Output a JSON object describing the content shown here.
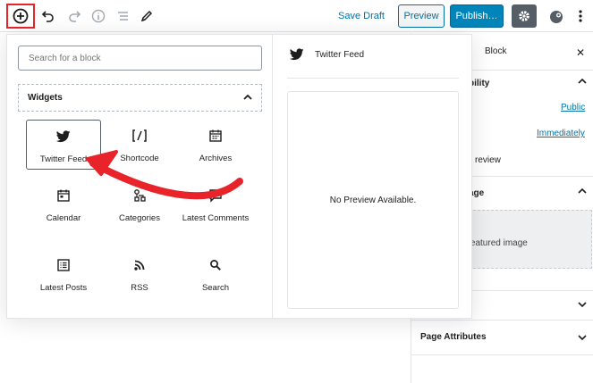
{
  "toolbar": {
    "save_draft": "Save Draft",
    "preview": "Preview",
    "publish": "Publish…",
    "icons": [
      "add-block-icon",
      "undo-icon",
      "redo-icon",
      "info-icon",
      "list-view-icon",
      "edit-pencil-icon",
      "gear-icon",
      "plugin-icon",
      "more-options-icon"
    ],
    "highlight_color": "#e8232a"
  },
  "inserter": {
    "search_placeholder": "Search for a block",
    "panel_title": "Widgets",
    "blocks": [
      {
        "label": "Twitter Feed",
        "icon": "twitter-icon",
        "selected": true
      },
      {
        "label": "Shortcode",
        "icon": "shortcode-icon"
      },
      {
        "label": "Archives",
        "icon": "calendar-archive-icon"
      },
      {
        "label": "Calendar",
        "icon": "calendar-icon"
      },
      {
        "label": "Categories",
        "icon": "categories-icon"
      },
      {
        "label": "Latest Comments",
        "icon": "comment-icon"
      },
      {
        "label": "Latest Posts",
        "icon": "posts-list-icon"
      },
      {
        "label": "RSS",
        "icon": "rss-icon"
      },
      {
        "label": "Search",
        "icon": "search-icon"
      }
    ],
    "preview": {
      "title": "Twitter Feed",
      "message": "No Preview Available."
    }
  },
  "sidebar": {
    "block_tab": "Block",
    "close": "✕",
    "visibility_label": "bility",
    "visibility_value": "Public",
    "publish_value": "Immediately",
    "pending_review": "review",
    "featured_image_label": "age",
    "featured_image_button": "et featured image",
    "page_attributes": "Page Attributes"
  },
  "annotation": {
    "arrow_color": "#e8232a"
  }
}
